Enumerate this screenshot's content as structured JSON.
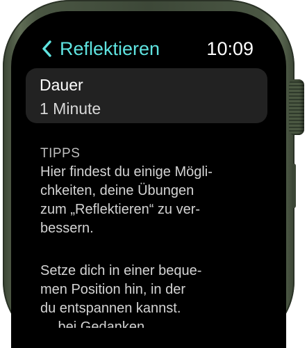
{
  "header": {
    "back_label": "Reflektieren",
    "time": "10:09",
    "accent_color": "#5fe3e0"
  },
  "duration": {
    "title": "Dauer",
    "value": "1 Minute"
  },
  "tips": {
    "heading": "TIPPS",
    "paragraph1_lines": [
      "Hier findest du einige Mögli-",
      "chkeiten, deine Übungen",
      "zum „Reflektieren“ zu ver-",
      "bessern."
    ],
    "paragraph2_lines": [
      "Setze dich in einer beque-",
      "men Position hin, in der",
      "du entspannen kannst.",
      "… bei Gedanken"
    ]
  },
  "icons": {
    "back": "chevron-left-icon",
    "crown": "digital-crown"
  }
}
